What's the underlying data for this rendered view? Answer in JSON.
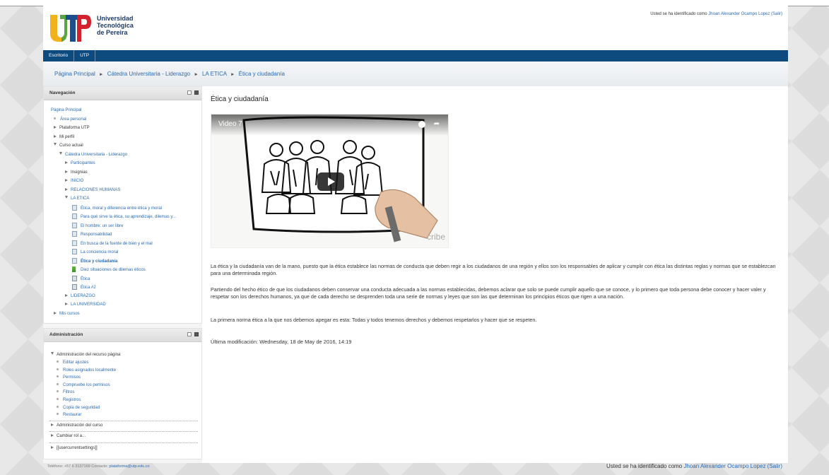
{
  "header": {
    "logo_text": [
      "Universidad",
      "Tecnológica",
      "de Pereira"
    ],
    "login_prefix": "Usted se ha identificado como ",
    "login_user": "Jhoan Alexander Ocampo Lopez",
    "login_logout": " (Salir)"
  },
  "navbar": {
    "items": [
      "Escritorio",
      "UTP"
    ]
  },
  "breadcrumb": {
    "items": [
      "Página Principal",
      "Cátedra Universitaria - Liderazgo",
      "LA ETICA",
      "Ética y ciudadanía"
    ],
    "separator": "►"
  },
  "navigation": {
    "title": "Navegación",
    "items": [
      {
        "label": "Página Principal",
        "indent": 0,
        "marker": "none",
        "link": true
      },
      {
        "label": "Área personal",
        "indent": 1,
        "marker": "dot",
        "link": true
      },
      {
        "label": "Plataforma UTP",
        "indent": 1,
        "marker": "tri-r",
        "link": false
      },
      {
        "label": "Mi perfil",
        "indent": 1,
        "marker": "tri-r",
        "link": false
      },
      {
        "label": "Curso actual",
        "indent": 1,
        "marker": "tri-d",
        "link": false
      },
      {
        "label": "Cátedra Universitaria - Liderazgo",
        "indent": 2,
        "marker": "tri-d",
        "link": true
      },
      {
        "label": "Participantes",
        "indent": 3,
        "marker": "tri-r",
        "link": true
      },
      {
        "label": "Insignias",
        "indent": 3,
        "marker": "tri-r",
        "link": false
      },
      {
        "label": "INICIO",
        "indent": 3,
        "marker": "tri-r",
        "link": true
      },
      {
        "label": "RELACIONES HUMANAS",
        "indent": 3,
        "marker": "tri-r",
        "link": true
      },
      {
        "label": "LA ETICA",
        "indent": 3,
        "marker": "tri-d",
        "link": true
      },
      {
        "label": "Ética, moral y diferencia entre ética y moral",
        "indent": 4,
        "marker": "page",
        "link": true
      },
      {
        "label": "Para qué sirve la ética, su aprendizaje, dilemas y...",
        "indent": 4,
        "marker": "page",
        "link": true
      },
      {
        "label": "El hombre: un ser libre",
        "indent": 4,
        "marker": "page",
        "link": true
      },
      {
        "label": "Responsabilidad",
        "indent": 4,
        "marker": "page",
        "link": true
      },
      {
        "label": "En busca de la fuente de bien y el mal",
        "indent": 4,
        "marker": "page",
        "link": true
      },
      {
        "label": "La conciencia moral",
        "indent": 4,
        "marker": "page",
        "link": true
      },
      {
        "label": "Ética y ciudadanía",
        "indent": 4,
        "marker": "page",
        "link": true,
        "bold": true
      },
      {
        "label": "Diez situaciones de dilemas éticos",
        "indent": 4,
        "marker": "green",
        "link": true
      },
      {
        "label": "Ética",
        "indent": 4,
        "marker": "booklet",
        "link": true
      },
      {
        "label": "Ética #2",
        "indent": 4,
        "marker": "booklet",
        "link": true
      },
      {
        "label": "LIDERAZGO",
        "indent": 3,
        "marker": "tri-r",
        "link": true
      },
      {
        "label": "LA UNIVERSIDAD",
        "indent": 3,
        "marker": "tri-r",
        "link": true
      },
      {
        "label": "Mis cursos",
        "indent": 1,
        "marker": "tri-r",
        "link": true
      }
    ]
  },
  "administration": {
    "title": "Administración",
    "section_label": "Administración del recurso página",
    "items": [
      "Editar ajustes",
      "Roles asignados localmente",
      "Permisos",
      "Compruebe los permisos",
      "Filtros",
      "Registros",
      "Copia de seguridad",
      "Restaurar"
    ],
    "course_admin": "Administración del curso",
    "switch_role": "Cambiar rol a...",
    "user_settings": "[[usercurrentsettings]]"
  },
  "main": {
    "title": "Ética y ciudadanía",
    "video_title": "Video 7",
    "video_watermark": "cribe",
    "paragraphs": [
      "La ética y la ciudadanía van de la mano, puesto que la ética establece las normas de conducta que deben regir a los ciudadanos de una región y ellos son los responsables de aplicar y cumplir con ética las distintas reglas y normas que se establezcan para una determinada región.",
      "Partiendo del hecho ético de que los ciudadanos deben conservar una conducta adecuada a las normas establecidas, debemos aclarar que solo se puede cumplir aquello que se conoce, y lo primero que toda persona debe conocer y hacer valer y respetar son los derechos humanos, ya que de cada derecho se desprenden toda una serie de normas y leyes que son las que determinan los principios éticos que rigen a una nación.",
      "La primera norma ética a la que nos debemos apegar es esta: Todas y todos tenemos derechos y debemos respetarlos y hacer que se respeten."
    ],
    "last_modified": "Última modificación: Wednesday, 18 de May de 2016, 14:19"
  },
  "footer": {
    "contact_prefix": "Teléfono: +57 6 3137169 Contacto: ",
    "contact_email": "plataforma@utp.edu.co",
    "login_prefix": "Usted se ha identificado como ",
    "login_user": "Jhoan Alexander Ocampo Lopez",
    "login_logout": " (Salir)"
  },
  "colors": {
    "navbar": "#0d4a7e",
    "link": "#2a6bb3",
    "logo_yellow": "#f2b21b",
    "logo_green": "#5aa543",
    "logo_blue": "#1d4f8f",
    "logo_red": "#d3212d"
  }
}
